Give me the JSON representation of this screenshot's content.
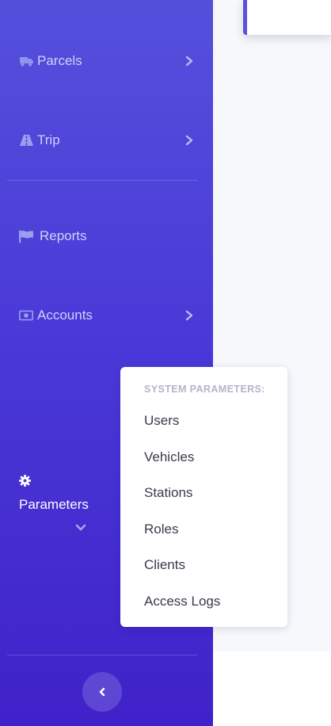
{
  "colors": {
    "sidebar_top": "#5550dc",
    "sidebar_bottom": "#3f22c9",
    "nav_text": "#cfd2f7",
    "accent": "#5a50e0",
    "content_bg": "#f7f8fc",
    "dropdown_header": "#b4b3cc",
    "dropdown_text": "#3a3a4a"
  },
  "sidebar": {
    "items": [
      {
        "label": "Parcels",
        "icon": "truck-icon",
        "has_submenu": true
      },
      {
        "label": "Trip",
        "icon": "road-icon",
        "has_submenu": true
      },
      {
        "label": "Reports",
        "icon": "flag-icon",
        "has_submenu": false
      },
      {
        "label": "Accounts",
        "icon": "money-bill-icon",
        "has_submenu": true
      }
    ],
    "active": {
      "label": "Parameters",
      "icon": "gear-icon",
      "expanded": true
    },
    "collapse_icon": "chevron-left-icon"
  },
  "dropdown": {
    "header": "SYSTEM PARAMETERS:",
    "items": [
      "Users",
      "Vehicles",
      "Stations",
      "Roles",
      "Clients",
      "Access Logs"
    ]
  }
}
